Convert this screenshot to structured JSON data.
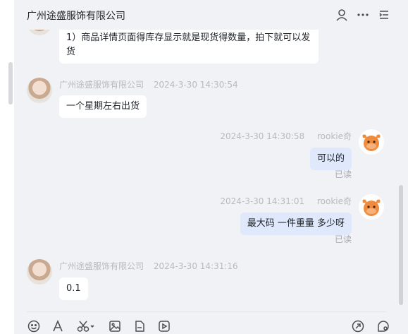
{
  "header": {
    "title": "广州途盛服饰有限公司"
  },
  "messages": [
    {
      "text": "1）商品详情页面得库存显示就是现货得数量，拍下就可以发货"
    },
    {
      "sender": "广州途盛服饰有限公司",
      "time": "2024-3-30 14:30:54",
      "text": "一个星期左右出货"
    },
    {
      "time": "2024-3-30 14:30:58",
      "sender": "rookie奇",
      "text": "可以的",
      "status": "已读"
    },
    {
      "time": "2024-3-30 14:31:01",
      "sender": "rookie奇",
      "text": "最大码 一件重量 多少呀",
      "status": "已读"
    },
    {
      "sender": "广州途盛服饰有限公司",
      "time": "2024-3-30 14:31:16",
      "text": "0.1"
    }
  ],
  "colors": {
    "own_bubble": "#dfe9fb",
    "other_bubble": "#ffffff",
    "background": "#f1f2f5"
  }
}
